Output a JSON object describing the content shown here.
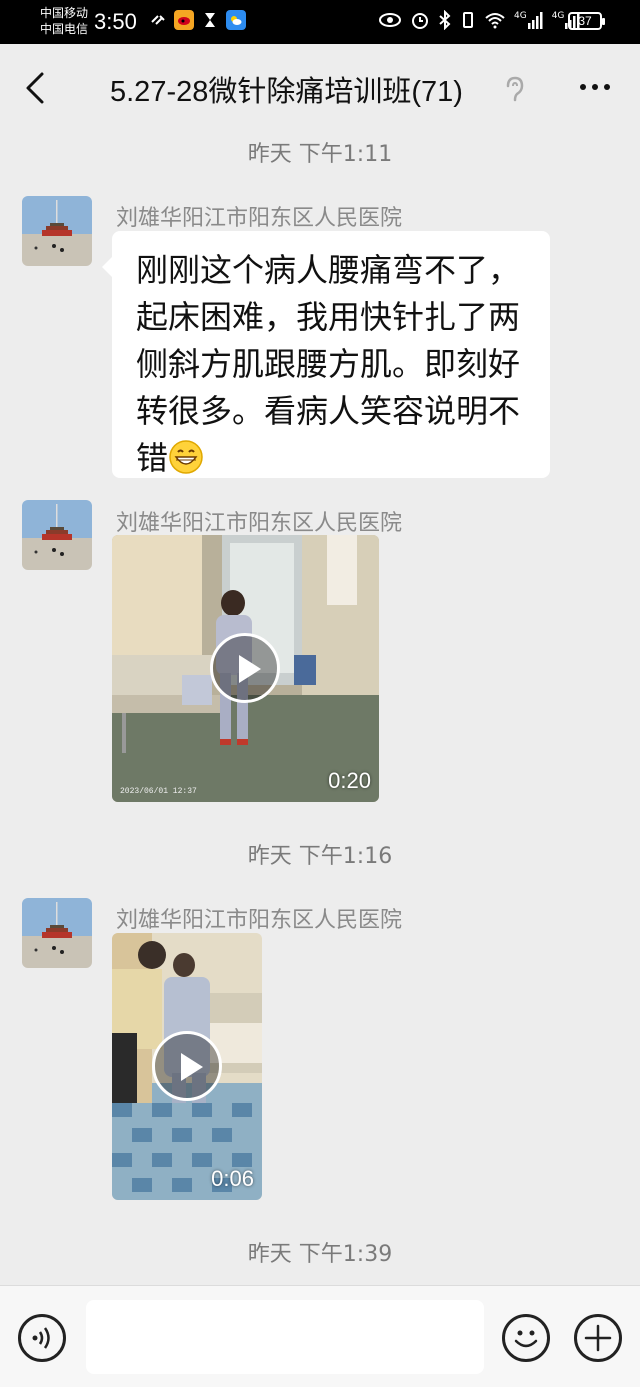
{
  "status_bar": {
    "carrier_1": "中国移动",
    "carrier_2": "中国电信",
    "time": "3:50",
    "battery": "37",
    "network_1": "4G",
    "network_2": "4G"
  },
  "header": {
    "title": "5.27-28微针除痛培训班(71)"
  },
  "messages": [
    {
      "type": "timestamp",
      "text": "昨天 下午1:11"
    },
    {
      "type": "text",
      "sender": "刘雄华阳江市阳东区人民医院",
      "lines": [
        "刚刚这个病人腰痛弯不了，",
        "起床困难，我用快针扎了两",
        "侧斜方肌跟腰方肌。即刻好",
        "转很多。看病人笑容说明不",
        "错"
      ]
    },
    {
      "type": "video",
      "sender": "刘雄华阳江市阳东区人民医院",
      "duration": "0:20",
      "stamp": "2023/06/01 12:37"
    },
    {
      "type": "timestamp",
      "text": "昨天 下午1:16"
    },
    {
      "type": "video",
      "sender": "刘雄华阳江市阳东区人民医院",
      "duration": "0:06"
    },
    {
      "type": "timestamp",
      "text": "昨天 下午1:39"
    }
  ],
  "input_bar": {
    "placeholder": ""
  }
}
